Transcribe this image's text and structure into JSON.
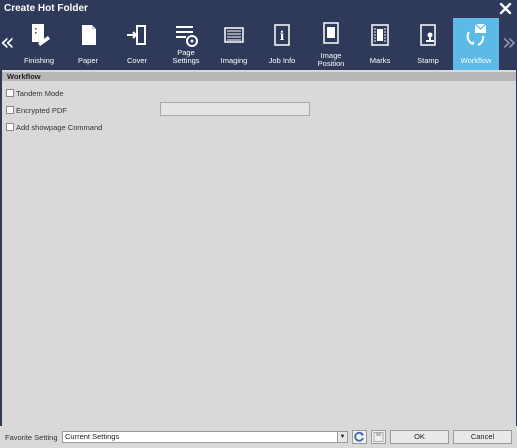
{
  "window": {
    "title": "Create Hot Folder"
  },
  "tabs": [
    {
      "id": "finishing",
      "label": "Finishing",
      "icon": "finishing-icon"
    },
    {
      "id": "paper",
      "label": "Paper",
      "icon": "paper-icon"
    },
    {
      "id": "cover",
      "label": "Cover",
      "icon": "cover-icon"
    },
    {
      "id": "page-settings",
      "label": "Page Settings",
      "icon": "page-settings-icon"
    },
    {
      "id": "imaging",
      "label": "Imaging",
      "icon": "imaging-icon"
    },
    {
      "id": "job-info",
      "label": "Job Info",
      "icon": "job-info-icon"
    },
    {
      "id": "image-position",
      "label": "Image Position",
      "icon": "image-position-icon"
    },
    {
      "id": "marks",
      "label": "Marks",
      "icon": "marks-icon"
    },
    {
      "id": "stamp",
      "label": "Stamp",
      "icon": "stamp-icon"
    },
    {
      "id": "workflow",
      "label": "Workflow",
      "icon": "workflow-icon"
    }
  ],
  "section": {
    "title": "Workflow"
  },
  "options": {
    "tandem_mode": {
      "label": "Tandem Mode",
      "checked": false
    },
    "encrypted_pdf": {
      "label": "Encrypted PDF",
      "checked": false
    },
    "encrypted_pdf_value": "",
    "add_showpage": {
      "label": "Add showpage Command",
      "checked": false
    }
  },
  "footer": {
    "favorite_label": "Favorite Setting",
    "favorite_value": "Current Settings",
    "ok_label": "OK",
    "cancel_label": "Cancel"
  },
  "colors": {
    "titlebar": "#2f3a5b",
    "active_tab": "#5db9e6",
    "panel": "#d9d9d9"
  }
}
